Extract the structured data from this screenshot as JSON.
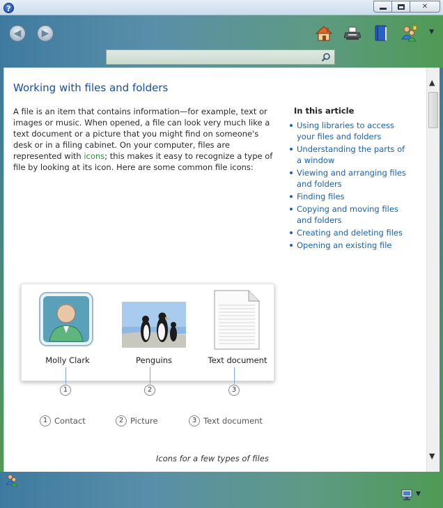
{
  "window": {
    "help_glyph": "?",
    "min_icon": "minimize-icon",
    "max_icon": "maximize-icon",
    "close_glyph": "✕"
  },
  "toolbar": {
    "back_icon": "back-arrow-icon",
    "forward_icon": "forward-arrow-icon",
    "home_icon": "home-icon",
    "print_icon": "printer-icon",
    "browse_icon": "book-icon",
    "ask_icon": "people-icon",
    "options_icon": "chevron-down-icon",
    "back_glyph": "◀",
    "forward_glyph": "▶",
    "caret_glyph": "▼"
  },
  "search": {
    "value": "",
    "placeholder": ""
  },
  "article": {
    "title": "Working with files and folders",
    "intro_part1": "A file is an item that contains information—for example, text or images or music. When opened, a file can look very much like a text document or a picture that you might find on someone's desk or in a filing cabinet. On your computer, files are represented with",
    "intro_link": "icons",
    "intro_part2": "; this makes it easy to recognize a type of file by looking at its icon. Here are some common file icons:",
    "toc_heading": "In this article",
    "toc_items": [
      "Using libraries to access your files and folders",
      "Understanding the parts of a window",
      "Viewing and arranging files and folders",
      "Finding files",
      "Copying and moving files and folders",
      "Creating and deleting files",
      "Opening an existing file"
    ]
  },
  "figure": {
    "items": [
      {
        "label": "Molly Clark",
        "num": "1",
        "icon": "contact-icon"
      },
      {
        "label": "Penguins",
        "num": "2",
        "icon": "picture-icon"
      },
      {
        "label": "Text document",
        "num": "3",
        "icon": "text-document-icon"
      }
    ],
    "legend": [
      {
        "num": "1",
        "label": "Contact"
      },
      {
        "num": "2",
        "label": "Picture"
      },
      {
        "num": "3",
        "label": "Text document"
      }
    ],
    "caption": "Icons for a few types of files"
  },
  "scrollbar": {
    "up_glyph": "▲",
    "down_glyph": "▼"
  },
  "status": {
    "people_icon": "people-icon",
    "connection_icon": "network-connection-icon",
    "caret_glyph": "▼"
  },
  "colors": {
    "link": "#1a62b0",
    "title": "#1c4fa0",
    "chrome_left": "#3e7aa0",
    "chrome_right": "#4f9a55"
  }
}
